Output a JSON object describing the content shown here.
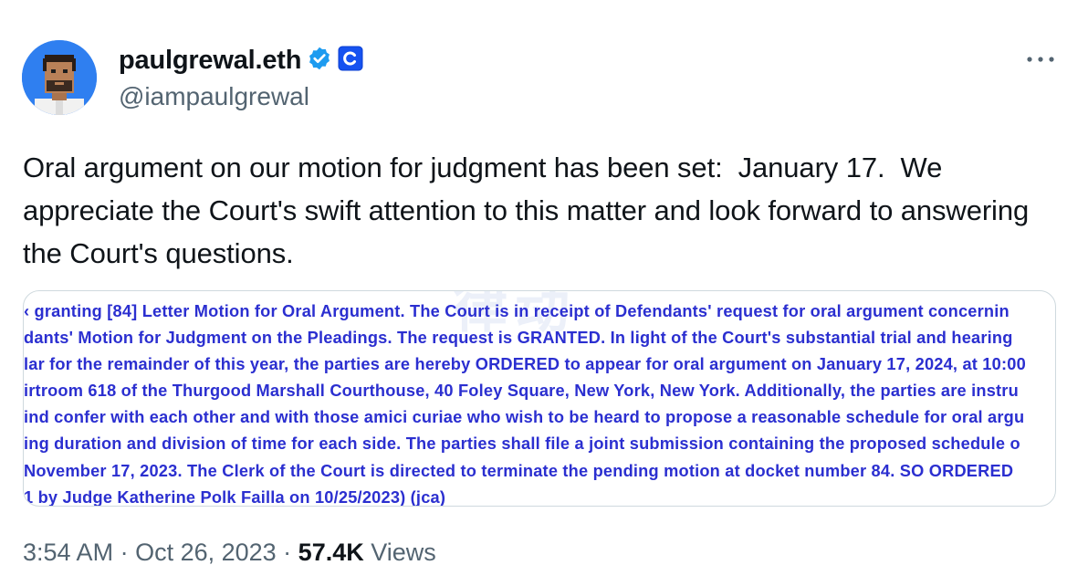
{
  "author": {
    "display_name": "paulgrewal.eth",
    "handle": "@iampaulgrewal",
    "verified_icon": "verified-badge-icon",
    "affiliation_icon": "coinbase-c-icon",
    "brand_color": "#1d9bf0",
    "affiliation_color": "#1652f0"
  },
  "menu": {
    "icon": "more-options-icon"
  },
  "tweet": {
    "text": "Oral argument on our motion for judgment has been set:  January 17.  We appreciate the Court's swift attention to this matter and look forward to answering the Court's questions."
  },
  "media": {
    "watermark": "律动",
    "lines": [
      "‹ granting [84] Letter Motion for Oral Argument. The Court is in receipt of Defendants' request for oral argument concernin",
      "dants' Motion for Judgment on the Pleadings. The request is GRANTED. In light of the Court's substantial trial and hearing",
      "lar for the remainder of this year, the parties are hereby ORDERED to appear for oral argument on January 17, 2024, at 10:00",
      "irtroom 618 of the Thurgood Marshall Courthouse, 40 Foley Square, New York, New York. Additionally, the parties are instru",
      "ind confer with each other and with those amici curiae who wish to be heard to propose a reasonable schedule for oral argu",
      "ing duration and division of time for each side. The parties shall file a joint submission containing the proposed schedule o",
      " November 17, 2023. The Clerk of the Court is directed to terminate the pending motion at docket number 84. SO ORDERED",
      "1 by Judge Katherine Polk Failla on 10/25/2023) (jca)"
    ],
    "text_color": "#2b2fd0"
  },
  "meta": {
    "time": "3:54 AM",
    "separator": " · ",
    "date": "Oct 26, 2023",
    "separator2": " · ",
    "views_count": "57.4K",
    "views_label": " Views"
  }
}
